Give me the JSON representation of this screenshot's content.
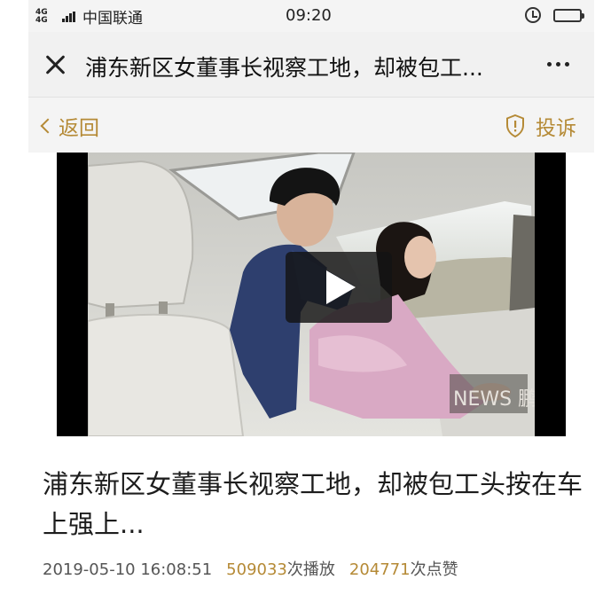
{
  "status_bar": {
    "network": "4G 4G",
    "carrier": "中国联通",
    "time": "09:20"
  },
  "header": {
    "title": "浦东新区女董事长视察工地，却被包工..."
  },
  "nav": {
    "back_label": "返回",
    "report_label": "投诉"
  },
  "article": {
    "headline": "浦东新区女董事长视察工地，却被包工头按在车上强上...",
    "date": "2019-05-10 16:08:51",
    "play_count": "509033",
    "play_unit": "次播放",
    "like_count": "204771",
    "like_unit": "次点赞",
    "watermark": "NEWS 鹏翔奇葩"
  },
  "colors": {
    "accent": "#b58a36",
    "text": "#1d1d1d",
    "meta_text": "#555555",
    "title_bar": "#f1f1f1"
  },
  "icons": [
    "close-icon",
    "more-icon",
    "chevron-left-icon",
    "shield-icon",
    "play-icon",
    "alarm-icon",
    "battery-icon"
  ]
}
